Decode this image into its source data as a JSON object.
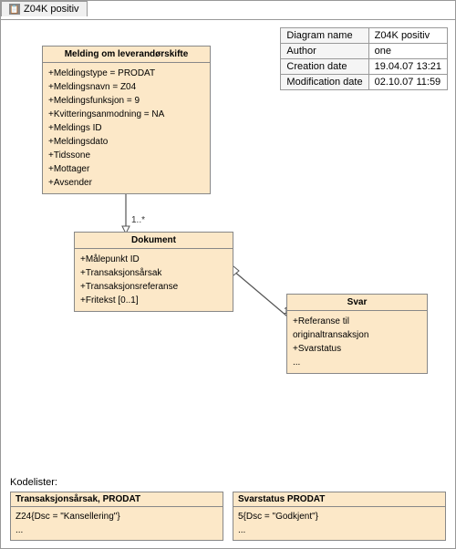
{
  "tab": {
    "icon": "📋",
    "label": "Z04K positiv"
  },
  "info_table": {
    "rows": [
      {
        "key": "Diagram name",
        "value": "Z04K positiv"
      },
      {
        "key": "Author",
        "value": "one"
      },
      {
        "key": "Creation date",
        "value": "19.04.07 13:21"
      },
      {
        "key": "Modification date",
        "value": "02.10.07 11:59"
      }
    ]
  },
  "melding_box": {
    "title": "Melding om leverandørskifte",
    "lines": [
      "+Meldingstype = PRODAT",
      "+Meldingsnavn = Z04",
      "+Meldingsfunksjon = 9",
      "+Kvitteringsanmodning = NA",
      "+Meldings ID",
      "+Meldingsdato",
      "+Tidssone",
      "+Mottager",
      "+Avsender"
    ]
  },
  "dokument_box": {
    "title": "Dokument",
    "lines": [
      "+Målepunkt ID",
      "+Transaksjonsårsak",
      "+Transaksjonsreferanse",
      "+Fritekst [0..1]"
    ]
  },
  "svar_box": {
    "title": "Svar",
    "lines": [
      "+Referanse til originaltransaksjon",
      "+Svarstatus",
      "..."
    ]
  },
  "multiplicity_1": "1..*",
  "multiplicity_2": "1",
  "codelists": {
    "label": "Kodelister:",
    "items": [
      {
        "title": "Transaksjonsårsak, PRODAT",
        "lines": [
          "Z24{Dsc = \"Kansellering\"}",
          "..."
        ]
      },
      {
        "title": "Svarstatus PRODAT",
        "lines": [
          "5{Dsc = \"Godkjent\"}",
          "..."
        ]
      }
    ]
  }
}
